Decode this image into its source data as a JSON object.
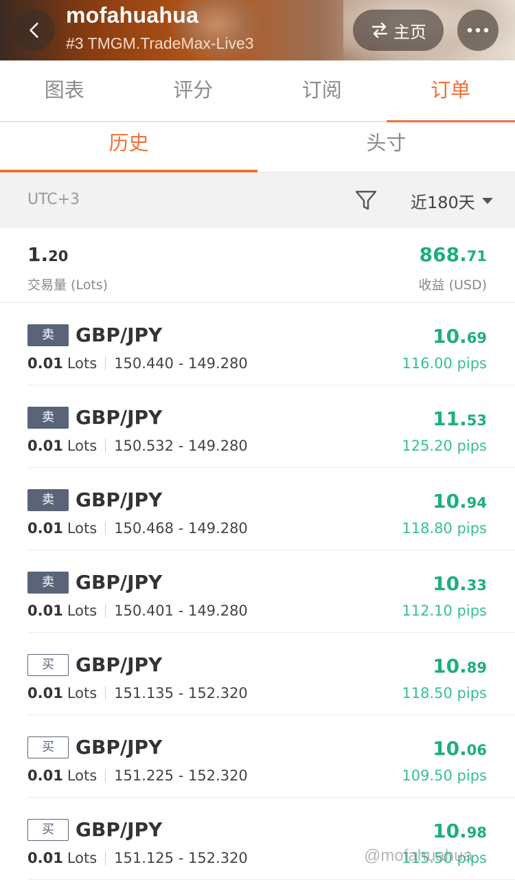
{
  "header": {
    "title": "mofahuahua",
    "subtitle": "#3 TMGM.TradeMax-Live3",
    "home_label": "主页"
  },
  "top_tabs": [
    {
      "label": "图表",
      "active": false
    },
    {
      "label": "评分",
      "active": false
    },
    {
      "label": "订阅",
      "active": false
    },
    {
      "label": "订单",
      "active": true
    }
  ],
  "sub_tabs": [
    {
      "label": "历史",
      "active": true
    },
    {
      "label": "头寸",
      "active": false
    }
  ],
  "filter": {
    "timezone": "UTC+3",
    "range": "近180天"
  },
  "summary": {
    "volume_int": "1.",
    "volume_dec": "20",
    "volume_label": "交易量 (Lots)",
    "profit_int": "868.",
    "profit_dec": "71",
    "profit_label": "收益 (USD)"
  },
  "orders": [
    {
      "side": "卖",
      "type": "sell",
      "symbol": "GBP/JPY",
      "lots": "0.01",
      "lots_unit": "Lots",
      "prices": "150.440 - 149.280",
      "profit_int": "10.",
      "profit_dec": "69",
      "pips": "116.00 pips"
    },
    {
      "side": "卖",
      "type": "sell",
      "symbol": "GBP/JPY",
      "lots": "0.01",
      "lots_unit": "Lots",
      "prices": "150.532 - 149.280",
      "profit_int": "11.",
      "profit_dec": "53",
      "pips": "125.20 pips"
    },
    {
      "side": "卖",
      "type": "sell",
      "symbol": "GBP/JPY",
      "lots": "0.01",
      "lots_unit": "Lots",
      "prices": "150.468 - 149.280",
      "profit_int": "10.",
      "profit_dec": "94",
      "pips": "118.80 pips"
    },
    {
      "side": "卖",
      "type": "sell",
      "symbol": "GBP/JPY",
      "lots": "0.01",
      "lots_unit": "Lots",
      "prices": "150.401 - 149.280",
      "profit_int": "10.",
      "profit_dec": "33",
      "pips": "112.10 pips"
    },
    {
      "side": "买",
      "type": "buy",
      "symbol": "GBP/JPY",
      "lots": "0.01",
      "lots_unit": "Lots",
      "prices": "151.135 - 152.320",
      "profit_int": "10.",
      "profit_dec": "89",
      "pips": "118.50 pips"
    },
    {
      "side": "买",
      "type": "buy",
      "symbol": "GBP/JPY",
      "lots": "0.01",
      "lots_unit": "Lots",
      "prices": "151.225 - 152.320",
      "profit_int": "10.",
      "profit_dec": "06",
      "pips": "109.50 pips"
    },
    {
      "side": "买",
      "type": "buy",
      "symbol": "GBP/JPY",
      "lots": "0.01",
      "lots_unit": "Lots",
      "prices": "151.125 - 152.320",
      "profit_int": "10.",
      "profit_dec": "98",
      "pips": "115.50 pips"
    }
  ],
  "watermark": "@mofahuahua",
  "colors": {
    "accent": "#f07038",
    "profit": "#1fae7c",
    "badge": "#5a6478"
  }
}
